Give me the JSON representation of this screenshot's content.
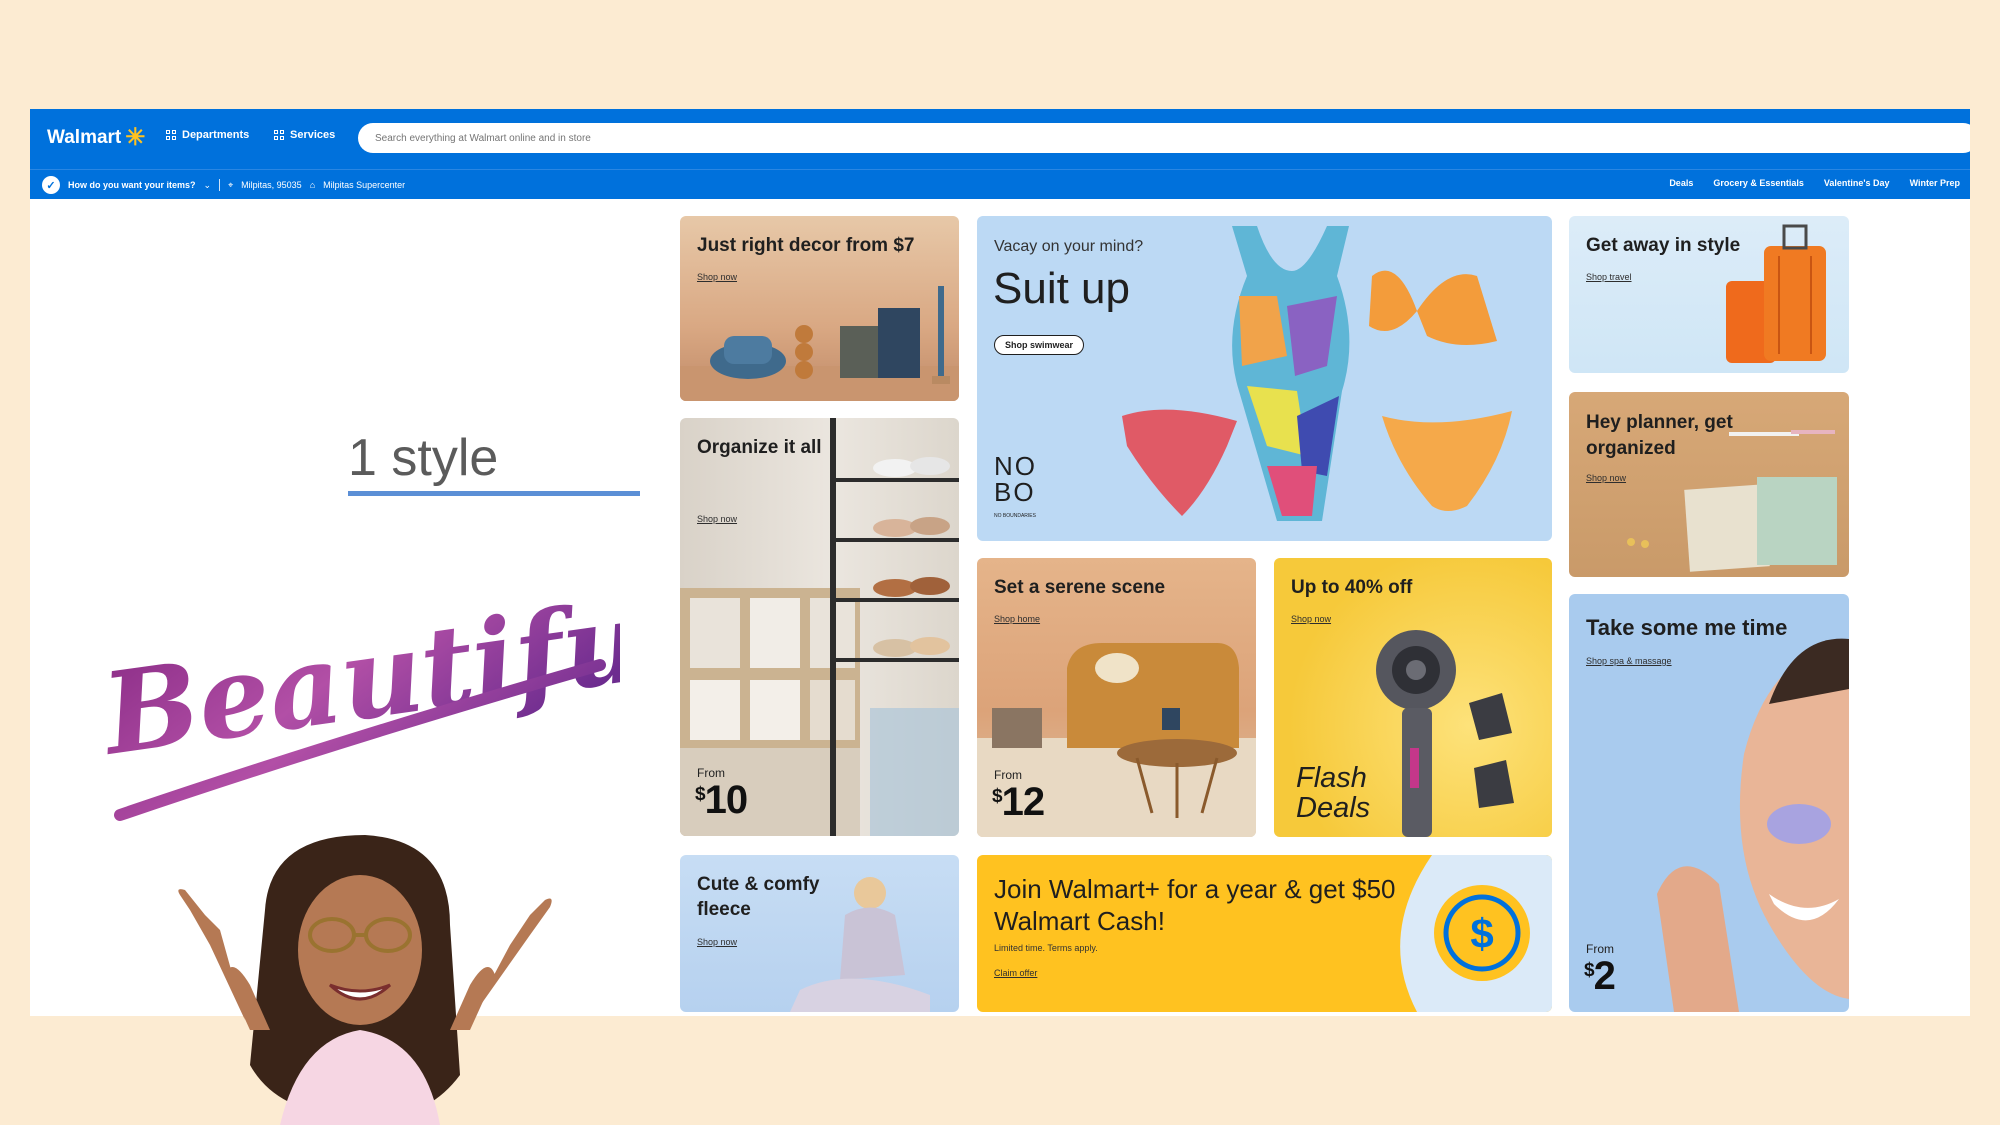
{
  "header": {
    "logo": "Walmart",
    "departments_label": "Departments",
    "services_label": "Services",
    "search_placeholder": "Search everything at Walmart online and in store"
  },
  "subbar": {
    "delivery_prompt": "How do you want your items?",
    "location": "Milpitas, 95035",
    "store": "Milpitas Supercenter",
    "links": [
      "Deals",
      "Grocery & Essentials",
      "Valentine's Day",
      "Winter Prep"
    ]
  },
  "tiles": {
    "decor": {
      "title": "Just right decor from $7",
      "link": "Shop now"
    },
    "organize": {
      "title": "Organize it all",
      "link": "Shop now",
      "from": "From",
      "price_sup": "$",
      "price": "10"
    },
    "fleece": {
      "title": "Cute & comfy fleece",
      "link": "Shop now"
    },
    "suit": {
      "subtitle": "Vacay on your mind?",
      "title": "Suit up",
      "button": "Shop swimwear",
      "brand": "NO BO",
      "brand_sub": "NO BOUNDARIES"
    },
    "serene": {
      "title": "Set a serene scene",
      "link": "Shop home",
      "from": "From",
      "price_sup": "$",
      "price": "12"
    },
    "flash": {
      "title": "Up to 40% off",
      "link": "Shop now",
      "flash_line1": "Flash",
      "flash_line2": "Deals"
    },
    "plus": {
      "title": "Join Walmart+ for a year & get $50 Walmart Cash!",
      "fine_print": "Limited time. Terms apply.",
      "link": "Claim offer"
    },
    "travel": {
      "title": "Get away in style",
      "link": "Shop travel"
    },
    "planner": {
      "title": "Hey planner, get organized",
      "link": "Shop now"
    },
    "metime": {
      "title": "Take some me time",
      "link": "Shop spa & massage",
      "from": "From",
      "price_sup": "$",
      "price": "2"
    }
  },
  "overlay": {
    "style_label": "1 style",
    "beautiful": "Beautiful"
  },
  "colors": {
    "walmart_blue": "#0071dc",
    "spark_yellow": "#ffc220",
    "background": "#fcebd2",
    "underline_blue": "#5b8fd6"
  }
}
